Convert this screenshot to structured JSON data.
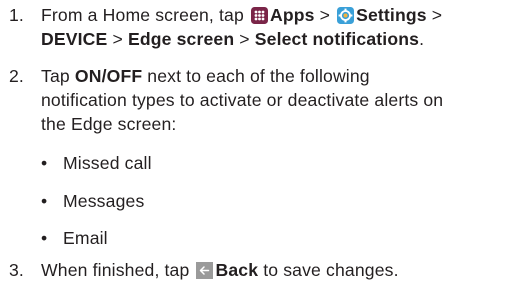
{
  "step1": {
    "number": "1.",
    "line1_pre": "From a Home screen, tap",
    "apps_label": "Apps",
    "sep1": ">",
    "settings_label": "Settings",
    "sep2": ">",
    "device_label": "DEVICE",
    "sep3": ">",
    "edge_label": "Edge screen",
    "sep4": ">",
    "select_label": "Select notifications",
    "end": "."
  },
  "step2": {
    "number": "2.",
    "pre": "Tap",
    "onoff_label": "ON/OFF",
    "line1_post": "next to each of the following",
    "line2": "notification types to activate or deactivate alerts on",
    "line3": "the Edge screen:"
  },
  "bullets": {
    "marker": "•",
    "items": [
      "Missed call",
      "Messages",
      "Email"
    ]
  },
  "step3": {
    "number": "3.",
    "pre": "When finished, tap",
    "back_label": "Back",
    "post": "to save changes."
  },
  "icons": {
    "apps": "apps-grid-icon",
    "settings": "settings-gear-icon",
    "back": "back-arrow-icon"
  },
  "colors": {
    "text": "#231f20",
    "apps_icon_bg": "#7a2548",
    "settings_icon_bg": "#3aa0d8",
    "back_icon_bg": "#9a9a9a"
  }
}
